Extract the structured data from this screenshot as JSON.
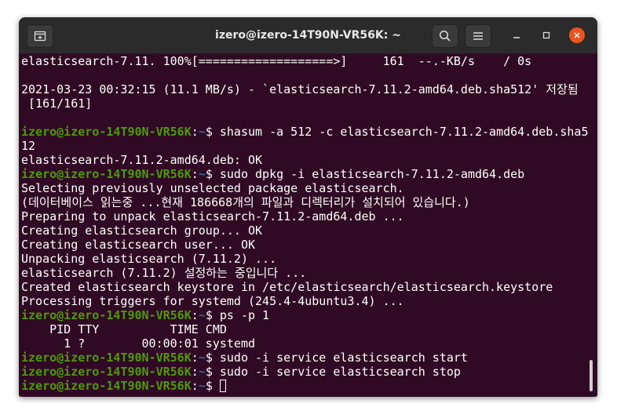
{
  "window": {
    "title": "izero@izero-14T90N-VR56K: ~"
  },
  "icons": {
    "new_tab": "new-tab-icon",
    "search": "search-icon",
    "menu": "hamburger-menu-icon",
    "minimize": "minimize-icon",
    "maximize": "maximize-icon",
    "close": "close-icon"
  },
  "colors": {
    "accent": "#e95420",
    "terminal_bg": "#300a24",
    "prompt_user": "#4e9a06",
    "prompt_path": "#3465a4"
  },
  "terminal": {
    "lines": [
      {
        "type": "text",
        "text": "elasticsearch-7.11. 100%[===================>]     161  --.-KB/s    / 0s"
      },
      {
        "type": "text",
        "text": ""
      },
      {
        "type": "text",
        "text": "2021-03-23 00:32:15 (11.1 MB/s) - `elasticsearch-7.11.2-amd64.deb.sha512' 저장됨"
      },
      {
        "type": "text",
        "text": " [161/161]"
      },
      {
        "type": "text",
        "text": ""
      },
      {
        "type": "prompt",
        "user": "izero@izero-14T90N-VR56K",
        "path": "~",
        "cmd": " shasum -a 512 -c elasticsearch-7.11.2-amd64.deb.sha5"
      },
      {
        "type": "text",
        "text": "12"
      },
      {
        "type": "text",
        "text": "elasticsearch-7.11.2-amd64.deb: OK"
      },
      {
        "type": "prompt",
        "user": "izero@izero-14T90N-VR56K",
        "path": "~",
        "cmd": " sudo dpkg -i elasticsearch-7.11.2-amd64.deb"
      },
      {
        "type": "text",
        "text": "Selecting previously unselected package elasticsearch."
      },
      {
        "type": "text",
        "text": "(데이터베이스 읽는중 ...현재 186668개의 파일과 디렉터리가 설치되어 있습니다.)"
      },
      {
        "type": "text",
        "text": "Preparing to unpack elasticsearch-7.11.2-amd64.deb ..."
      },
      {
        "type": "text",
        "text": "Creating elasticsearch group... OK"
      },
      {
        "type": "text",
        "text": "Creating elasticsearch user... OK"
      },
      {
        "type": "text",
        "text": "Unpacking elasticsearch (7.11.2) ..."
      },
      {
        "type": "text",
        "text": "elasticsearch (7.11.2) 설정하는 중입니다 ..."
      },
      {
        "type": "text",
        "text": "Created elasticsearch keystore in /etc/elasticsearch/elasticsearch.keystore"
      },
      {
        "type": "text",
        "text": "Processing triggers for systemd (245.4-4ubuntu3.4) ..."
      },
      {
        "type": "prompt",
        "user": "izero@izero-14T90N-VR56K",
        "path": "~",
        "cmd": " ps -p 1"
      },
      {
        "type": "text",
        "text": "    PID TTY          TIME CMD"
      },
      {
        "type": "text",
        "text": "      1 ?        00:00:01 systemd"
      },
      {
        "type": "prompt",
        "user": "izero@izero-14T90N-VR56K",
        "path": "~",
        "cmd": " sudo -i service elasticsearch start"
      },
      {
        "type": "prompt",
        "user": "izero@izero-14T90N-VR56K",
        "path": "~",
        "cmd": " sudo -i service elasticsearch stop"
      },
      {
        "type": "prompt",
        "user": "izero@izero-14T90N-VR56K",
        "path": "~",
        "cmd": " ",
        "cursor": true
      }
    ]
  }
}
